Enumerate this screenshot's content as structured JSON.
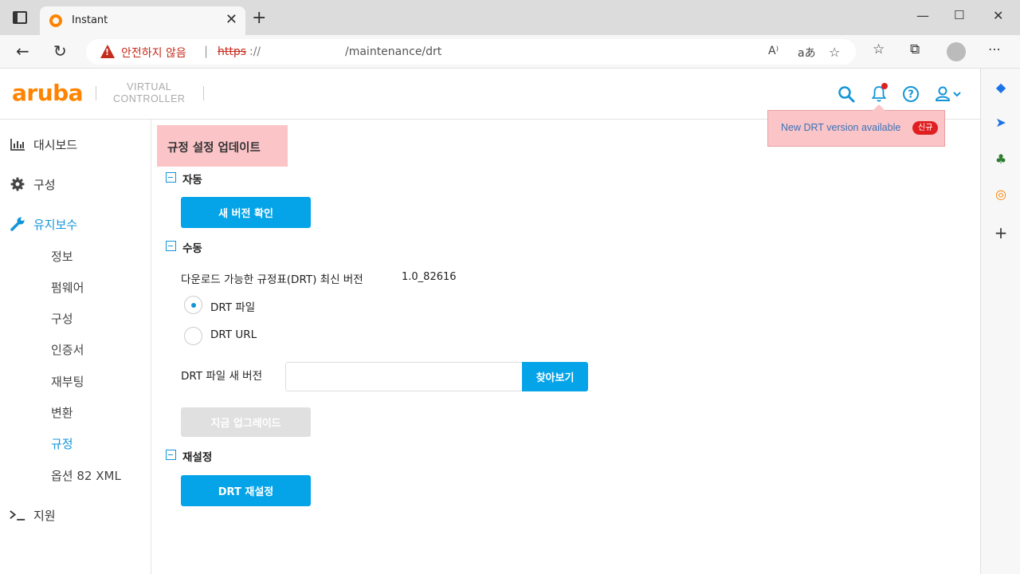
{
  "browser": {
    "tab_title": "Instant",
    "tab_close": "✕",
    "new_tab": "+",
    "security_warning": "안전하지 않음",
    "url_scheme": "https",
    "url_slashes": "://",
    "url_path": "/maintenance/drt",
    "minimize": "—",
    "maximize": "☐",
    "close": "✕"
  },
  "header": {
    "logo": "aruba",
    "product_line1": "VIRTUAL",
    "product_line2": "CONTROLLER"
  },
  "notification": {
    "text": "New DRT version available",
    "badge": "신규"
  },
  "nav": {
    "dashboard": "대시보드",
    "config": "구성",
    "maintenance": "유지보수",
    "support": "지원",
    "sub_items": [
      "정보",
      "펌웨어",
      "구성",
      "인증서",
      "재부팅",
      "변환",
      "규정",
      "옵션 82 XML"
    ],
    "active_sub": "규정"
  },
  "main": {
    "title": "규정 설정 업데이트",
    "section_auto": "자동",
    "check_new_version_button": "새 버전 확인",
    "section_manual": "수동",
    "latest_label": "다운로드 가능한 규정표(DRT) 최신 버전",
    "latest_value": "1.0_82616",
    "radio_file": "DRT 파일",
    "radio_url": "DRT URL",
    "radio_selected": "DRT 파일",
    "file_new_version_label": "DRT 파일 새 버전",
    "file_input_value": "",
    "browse_button": "찾아보기",
    "upgrade_now_button": "지금 업그레이드",
    "section_reset": "재설정",
    "reset_button": "DRT 재설정"
  },
  "colors": {
    "accent": "#05a4e8",
    "brand": "#ff8300",
    "highlight": "#fbc4c7",
    "badge": "#e02020"
  }
}
